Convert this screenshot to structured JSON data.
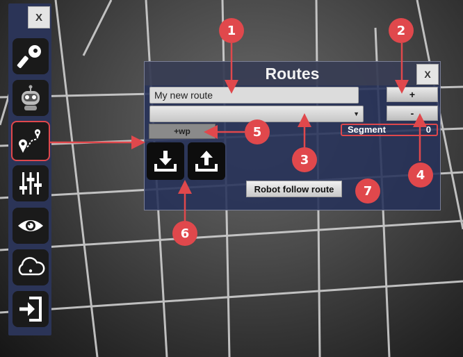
{
  "toolbar": {
    "close_label": "X",
    "items": [
      {
        "icon": "key-icon"
      },
      {
        "icon": "robot-icon"
      },
      {
        "icon": "route-icon",
        "active": true
      },
      {
        "icon": "sliders-icon"
      },
      {
        "icon": "eye-icon"
      },
      {
        "icon": "cloud-icon"
      },
      {
        "icon": "exit-icon"
      }
    ]
  },
  "routes_panel": {
    "title": "Routes",
    "close_label": "X",
    "route_name_value": "My new route",
    "route_select_value": "",
    "add_label": "+",
    "remove_label": "-",
    "add_waypoint_label": "+wp",
    "segment_label": "Segment",
    "segment_value": "0",
    "download_icon": "download-icon",
    "upload_icon": "upload-icon",
    "follow_label": "Robot follow route"
  },
  "annotations": [
    "1",
    "2",
    "3",
    "4",
    "5",
    "6",
    "7"
  ],
  "colors": {
    "accent": "#e0484c",
    "panel": "#263159",
    "toolbar": "#2b3457"
  }
}
